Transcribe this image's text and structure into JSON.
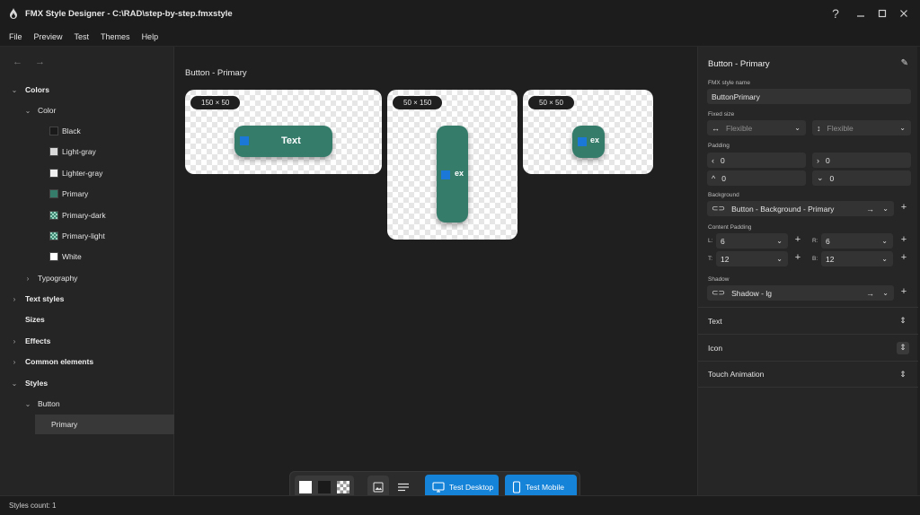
{
  "window": {
    "title": "FMX Style Designer - C:\\RAD\\step-by-step.fmxstyle"
  },
  "menu": [
    "File",
    "Preview",
    "Test",
    "Themes",
    "Help"
  ],
  "tree": {
    "colors": "Colors",
    "color": "Color",
    "swatches": [
      {
        "label": "Black",
        "color": "#1a1a1a"
      },
      {
        "label": "Light-gray",
        "color": "#d9d9d9"
      },
      {
        "label": "Lighter-gray",
        "color": "#efefef"
      },
      {
        "label": "Primary",
        "color": "#357c6b"
      },
      {
        "label": "Primary-dark",
        "color": "#2a6656"
      },
      {
        "label": "Primary-light",
        "color": "#5aa08d"
      },
      {
        "label": "White",
        "color": "#ffffff"
      }
    ],
    "typography": "Typography",
    "text_styles": "Text styles",
    "sizes": "Sizes",
    "effects": "Effects",
    "common_elements": "Common elements",
    "styles": "Styles",
    "button": "Button",
    "primary": "Primary"
  },
  "status": {
    "text": "Styles count: 1"
  },
  "canvas": {
    "title": "Button - Primary",
    "previews": [
      {
        "size_label": "150 × 50",
        "text": "Text"
      },
      {
        "size_label": "50 × 150",
        "text": "ex"
      },
      {
        "size_label": "50 × 50",
        "text": "ex"
      }
    ]
  },
  "toolbar": {
    "test_desktop": "Test Desktop",
    "test_mobile": "Test Mobile"
  },
  "props": {
    "title": "Button - Primary",
    "style_name_label": "FMX style name",
    "style_name_value": "ButtonPrimary",
    "fixed_size_label": "Fixed size",
    "fixed_width": "Flexible",
    "fixed_height": "Flexible",
    "padding_label": "Padding",
    "padding_left": "0",
    "padding_right": "0",
    "padding_top": "0",
    "padding_bottom": "0",
    "background_label": "Background",
    "background_value": "Button - Background - Primary",
    "content_padding_label": "Content Padding",
    "cp_l_label": "L:",
    "cp_l": "6",
    "cp_r_label": "R:",
    "cp_r": "6",
    "cp_t_label": "T:",
    "cp_t": "12",
    "cp_b_label": "B:",
    "cp_b": "12",
    "shadow_label": "Shadow",
    "shadow_value": "Shadow - lg",
    "sections": [
      "Text",
      "Icon",
      "Touch Animation"
    ]
  }
}
